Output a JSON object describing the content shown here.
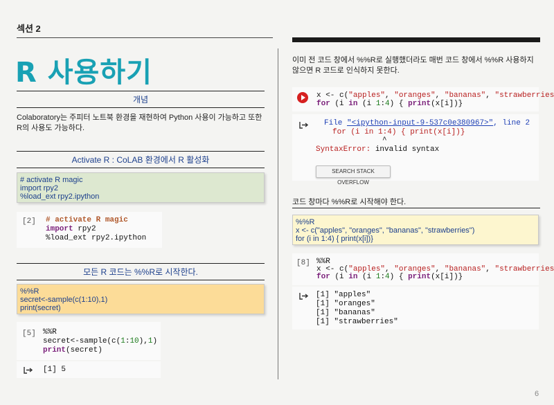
{
  "header": {
    "section_label": "섹션 2"
  },
  "title": "R 사용하기",
  "concept": {
    "heading": "개념",
    "body": "Colaboratory는 주피터 노트북 환경을 재현하여 Python 사용이 가능하고 또한 R의 사용도 가능하다."
  },
  "activate": {
    "heading": "Activate R : CoLAB 환경에서 R 활성화",
    "note_lines": [
      "# activate R magic",
      "import rpy2",
      "%load_ext rpy2.ipython"
    ],
    "cell_number": "[2]",
    "code": {
      "comment": "# activate R magic",
      "import_kw": "import",
      "import_rest": " rpy2",
      "line3": "%load_ext rpy2.ipython"
    }
  },
  "start": {
    "heading": "모든 R 코드는 %%R로 시작한다.",
    "note_lines": [
      "%%R",
      "secret<-sample(c(1:10),1)",
      "print(secret)"
    ],
    "cell_number": "[5]",
    "code": {
      "line1": "%%R",
      "line2_a": "secret<-sample(c(",
      "line2_num1": "1",
      "line2_b": ":",
      "line2_num2": "10",
      "line2_c": "),",
      "line2_num3": "1",
      "line2_d": ")",
      "print_kw": "print",
      "line3_rest": "(secret)"
    },
    "output": "[1] 5"
  },
  "right_top_text": "이미 전 코드 창에서 %%R로 실행했더라도 매번 코드 창에서 %%R 사용하지 않으면 R 코드로 인식하지 못한다.",
  "error_cell": {
    "code": {
      "l1_a": "x <- c(",
      "s1": "\"apples\"",
      "sep": ", ",
      "s2": "\"oranges\"",
      "s3": "\"bananas\"",
      "s4": "\"strawberries\"",
      "l1_end": ")",
      "for_kw": "for",
      "l2_a": " (i ",
      "in_kw": "in",
      "l2_num1": "1",
      "l2_b": ":",
      "l2_num2": "4",
      "l2_c": ") { ",
      "print_kw": "print",
      "l2_d": "(x[i])}"
    },
    "err_file_kw": "File ",
    "err_file_link": "\"<ipython-input-9-537c0e380967>\"",
    "err_line": ", line 2",
    "err_code": "for (i in 1:4) { print(x[i])}",
    "err_caret": "^",
    "err_msg_kw": "SyntaxError:",
    "err_msg": " invalid syntax",
    "button_label": "SEARCH STACK OVERFLOW"
  },
  "each_cell": {
    "heading": "코드 창마다 %%R로 시작해야 한다.",
    "note_lines": [
      "%%R",
      "x <- c(\"apples\", \"oranges\", \"bananas\", \"strawberries\")",
      "for (i in 1:4) { print(x[i])}"
    ],
    "cell_number": "[8]",
    "code_line1": "%%R",
    "outputs": [
      "[1] \"apples\"",
      "[1] \"oranges\"",
      "[1] \"bananas\"",
      "[1] \"strawberries\""
    ]
  },
  "page_number": "6"
}
